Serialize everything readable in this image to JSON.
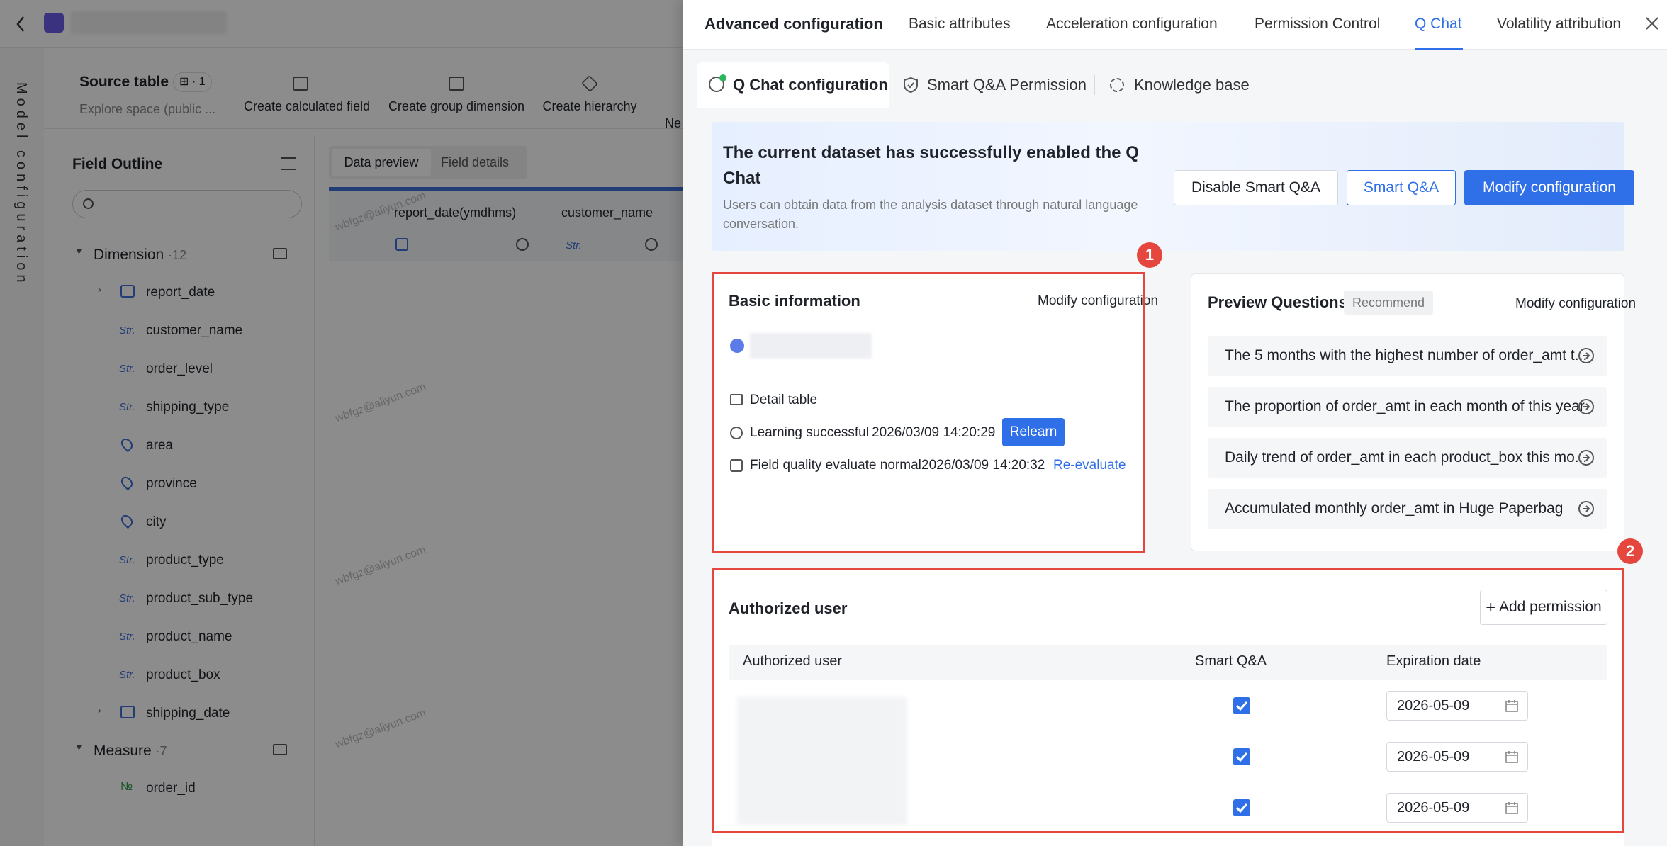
{
  "bg": {
    "source_table": "Source table",
    "source_badge": "⊞ · 1",
    "source_sub": "Explore space (public ...",
    "tools": [
      "Create calculated field",
      "Create group dimension",
      "Create hierarchy",
      "Ne"
    ],
    "side_label": "Model configuration",
    "field_outline": "Field Outline",
    "dimension": "Dimension",
    "dimension_count": "·12",
    "measure": "Measure",
    "measure_count": "·7",
    "fields": [
      "report_date",
      "customer_name",
      "order_level",
      "shipping_type",
      "area",
      "province",
      "city",
      "product_type",
      "product_sub_type",
      "product_name",
      "product_box",
      "shipping_date"
    ],
    "field_types": [
      "",
      "Str.",
      "Str.",
      "Str.",
      "",
      "",
      "",
      "Str.",
      "Str.",
      "Str.",
      "Str.",
      ""
    ],
    "measure_fields": [
      "order_id"
    ],
    "measure_type": "№",
    "preview_tabs": [
      "Data preview",
      "Field details"
    ],
    "columns": [
      "report_date(ymdhms)",
      "customer_name"
    ],
    "col_type": "Str.",
    "watermark": "wbfgz@aliyun.com"
  },
  "tabs": [
    "Advanced configuration",
    "Basic attributes",
    "Acceleration configuration",
    "Permission Control",
    "Q Chat",
    "Volatility attribution"
  ],
  "subtabs": [
    "Q Chat configuration",
    "Smart Q&A Permission",
    "Knowledge base"
  ],
  "banner": {
    "title_line1": "The current dataset has successfully enabled the Q",
    "title_line2": "Chat",
    "desc_line1": "Users can obtain data from the analysis dataset through natural language",
    "desc_line2": "conversation.",
    "btn_disable": "Disable Smart Q&A",
    "btn_smart": "Smart Q&A",
    "btn_modify": "Modify configuration"
  },
  "basic": {
    "title": "Basic information",
    "modify": "Modify configuration",
    "detail": "Detail table",
    "learning": "Learning successful",
    "learning_time": "2026/03/09 14:20:29",
    "relearn": "Relearn",
    "quality": "Field quality evaluate normal",
    "quality_time": "2026/03/09 14:20:32",
    "reevaluate": "Re-evaluate"
  },
  "preview": {
    "title": "Preview Questions",
    "tag": "Recommend",
    "modify": "Modify configuration",
    "questions": [
      "The 5 months with the highest number of order_amt t...",
      "The proportion of order_amt in each month of this year",
      "Daily trend of order_amt in each product_box this mo...",
      "Accumulated monthly order_amt in Huge Paperbag"
    ]
  },
  "auth": {
    "title": "Authorized user",
    "add": "Add permission",
    "headers": [
      "Authorized user",
      "Smart Q&A",
      "Expiration date"
    ],
    "dates": [
      "2026-05-09",
      "2026-05-09",
      "2026-05-09"
    ]
  },
  "markers": [
    "1",
    "2"
  ],
  "colors": {
    "accent": "#2f6fe8",
    "highlight": "#e5473e"
  }
}
